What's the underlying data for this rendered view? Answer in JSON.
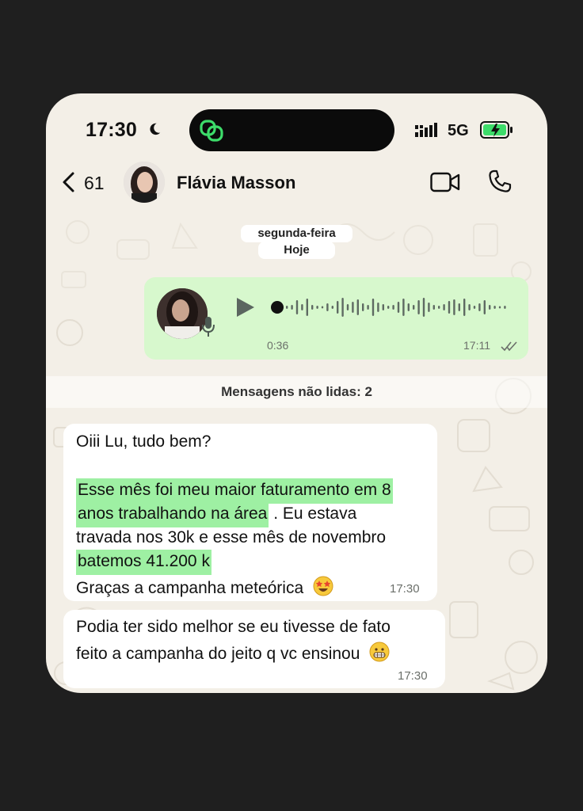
{
  "status_bar": {
    "time": "17:30",
    "network": "5G"
  },
  "header": {
    "back_count": "61",
    "contact_name": "Flávia Masson"
  },
  "date_chips": {
    "day": "segunda-feira",
    "today": "Hoje"
  },
  "voice_message": {
    "duration": "0:36",
    "time": "17:11",
    "status": "read"
  },
  "unread_banner": "Mensagens não lidas: 2",
  "messages": [
    {
      "lines": [
        {
          "text": "Oiii Lu, tudo bem?",
          "highlight": false
        },
        {
          "text": "",
          "highlight": false
        },
        {
          "text": "Esse mês foi meu maior faturamento em 8",
          "highlight": true
        },
        {
          "text_hl": "anos trabalhando na área",
          "text_rest": " . Eu estava"
        },
        {
          "text": "travada nos 30k e esse mês de novembro",
          "highlight": false
        },
        {
          "text": "batemos 41.200 k",
          "highlight": true
        },
        {
          "text": "Graças a campanha meteórica",
          "emoji": "star-struck-emoji"
        }
      ],
      "time": "17:30"
    },
    {
      "lines": [
        {
          "text": "Podia ter sido melhor se  eu tivesse de fato"
        },
        {
          "text": "feito a campanha do jeito q vc ensinou",
          "emoji": "grimacing-emoji"
        }
      ],
      "time": "17:30"
    }
  ],
  "colors": {
    "bubble_out": "#d7f8cd",
    "highlight": "#9ef0a3",
    "chat_bg": "#f3efe7"
  }
}
